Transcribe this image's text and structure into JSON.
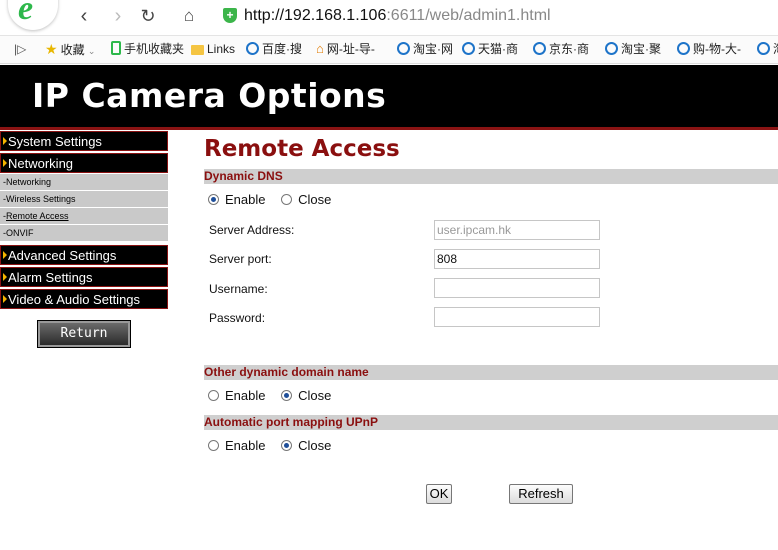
{
  "browser": {
    "url_host": "http://192.168.1.106",
    "url_rest": ":6611/web/admin1.html",
    "bookmarks": [
      "收藏",
      "手机收藏夹",
      "Links",
      "百度·搜",
      "网-址-导-",
      "淘宝·网",
      "天猫·商",
      "京东·商",
      "淘宝·聚",
      "购-物-大-",
      "淘"
    ]
  },
  "banner": {
    "title": "IP Camera Options"
  },
  "sidebar": {
    "system_settings": "System Settings",
    "networking": "Networking",
    "subitems": [
      "Networking",
      "Wireless Settings",
      "Remote Access",
      "ONVIF"
    ],
    "advanced_settings": "Advanced Settings",
    "alarm_settings": "Alarm Settings",
    "video_audio_settings": "Video & Audio Settings",
    "return_label": "Return"
  },
  "main": {
    "title": "Remote Access",
    "ddns": {
      "header": "Dynamic DNS",
      "enable": "Enable",
      "close": "Close",
      "selected": "enable",
      "server_address_label": "Server Address:",
      "server_address_value": "user.ipcam.hk",
      "server_port_label": "Server port:",
      "server_port_value": "808",
      "username_label": "Username:",
      "username_value": "",
      "password_label": "Password:",
      "password_value": ""
    },
    "other_ddns": {
      "header": "Other dynamic domain name",
      "enable": "Enable",
      "close": "Close",
      "selected": "close"
    },
    "upnp": {
      "header": "Automatic port mapping UPnP",
      "enable": "Enable",
      "close": "Close",
      "selected": "close"
    },
    "ok_label": "OK",
    "refresh_label": "Refresh"
  }
}
